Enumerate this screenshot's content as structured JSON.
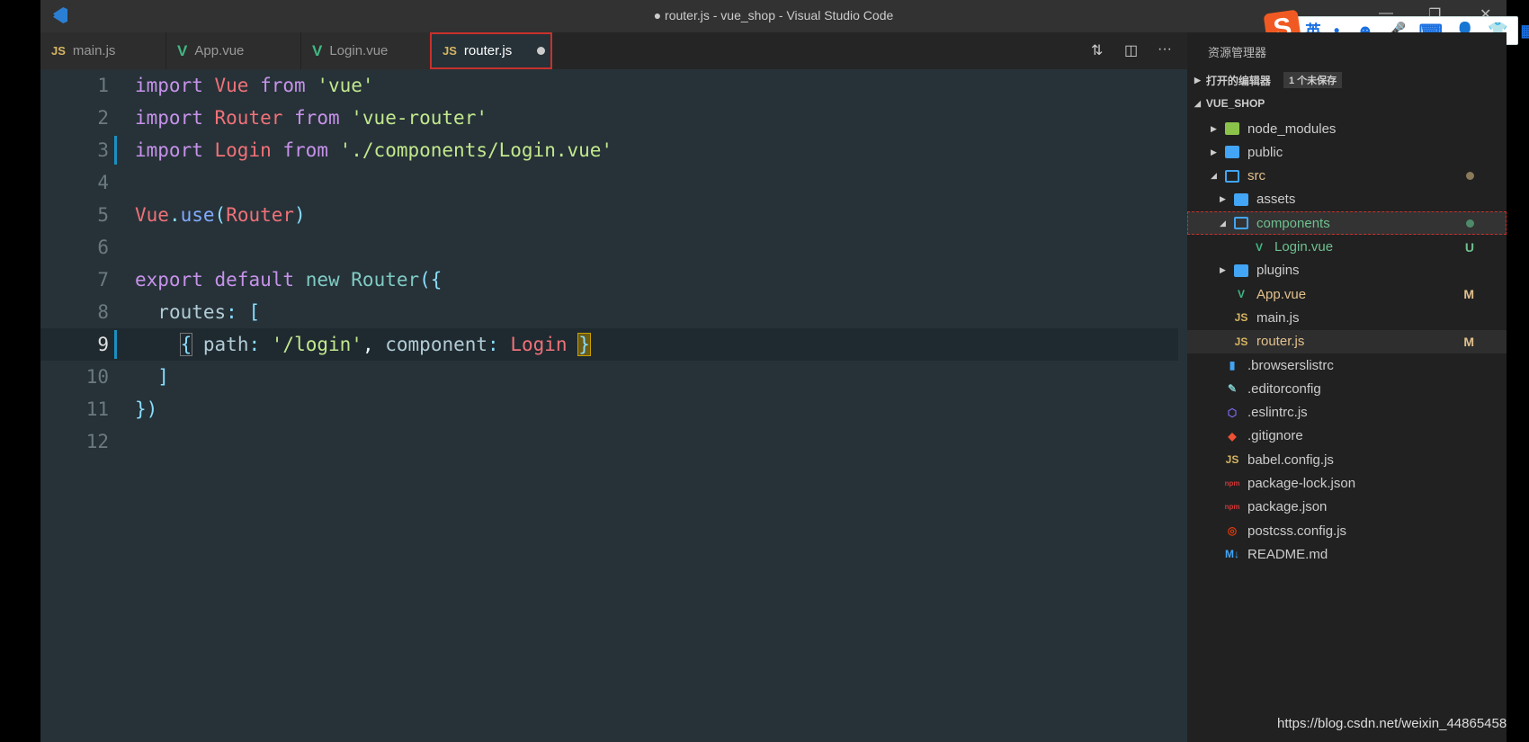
{
  "window": {
    "title": "● router.js - vue_shop - Visual Studio Code",
    "min": "—",
    "restore": "❐",
    "close": "✕"
  },
  "ime": {
    "logo": "S",
    "items": [
      "英",
      "•,",
      "☻",
      "🎤",
      "⌨",
      "👤",
      "👕",
      "▦"
    ]
  },
  "tabs": [
    {
      "label": "main.js",
      "icon": "js"
    },
    {
      "label": "App.vue",
      "icon": "vue"
    },
    {
      "label": "Login.vue",
      "icon": "vue"
    },
    {
      "label": "router.js",
      "icon": "js",
      "active": true,
      "unsaved": true
    }
  ],
  "tab_icons": {
    "js": "JS",
    "vue": "V"
  },
  "editor_actions": {
    "compare": "⇅",
    "split": "◫",
    "more": "···"
  },
  "code": {
    "line_numbers": [
      "1",
      "2",
      "3",
      "4",
      "5",
      "6",
      "7",
      "8",
      "9",
      "10",
      "11",
      "12"
    ],
    "l1": [
      "import",
      "Vue",
      "from",
      "'vue'"
    ],
    "l2": [
      "import",
      "Router",
      "from",
      "'vue-router'"
    ],
    "l3": [
      "import",
      "Login",
      "from",
      "'./components/Login.vue'"
    ],
    "l5": [
      "Vue",
      ".",
      "use",
      "(",
      "Router",
      ")"
    ],
    "l7": [
      "export",
      "default",
      "new",
      "Router",
      "({"
    ],
    "l8": [
      "routes",
      ":",
      "["
    ],
    "l9": [
      "{",
      "path",
      ":",
      "'/login'",
      ",",
      "component",
      ":",
      "Login",
      "}"
    ],
    "l10": [
      "]"
    ],
    "l11": [
      "})"
    ]
  },
  "sidebar": {
    "title": "资源管理器",
    "open_editors": "打开的编辑器",
    "unsaved_badge": "1 个未保存",
    "project": "VUE_SHOP",
    "items": [
      {
        "name": "node_modules",
        "icon": "node-folder",
        "expanded": false
      },
      {
        "name": "public",
        "icon": "folder",
        "expanded": false
      },
      {
        "name": "src",
        "icon": "folder-open",
        "expanded": true,
        "status_dot": "#8a7a5a"
      },
      {
        "name": "assets",
        "icon": "folder",
        "expanded": false
      },
      {
        "name": "components",
        "icon": "folder-open",
        "expanded": true,
        "status_dot": "#4e8a6a"
      },
      {
        "name": "Login.vue",
        "icon": "vue",
        "status": "U"
      },
      {
        "name": "plugins",
        "icon": "folder",
        "expanded": false
      },
      {
        "name": "App.vue",
        "icon": "vue",
        "status": "M"
      },
      {
        "name": "main.js",
        "icon": "js"
      },
      {
        "name": "router.js",
        "icon": "js",
        "status": "M"
      },
      {
        "name": ".browserslistrc",
        "icon": "file"
      },
      {
        "name": ".editorconfig",
        "icon": "editorconfig"
      },
      {
        "name": ".eslintrc.js",
        "icon": "eslint"
      },
      {
        "name": ".gitignore",
        "icon": "git"
      },
      {
        "name": "babel.config.js",
        "icon": "js"
      },
      {
        "name": "package-lock.json",
        "icon": "npm"
      },
      {
        "name": "package.json",
        "icon": "npm"
      },
      {
        "name": "postcss.config.js",
        "icon": "postcss"
      },
      {
        "name": "README.md",
        "icon": "markdown"
      }
    ]
  },
  "watermark": "https://blog.csdn.net/weixin_44865458"
}
